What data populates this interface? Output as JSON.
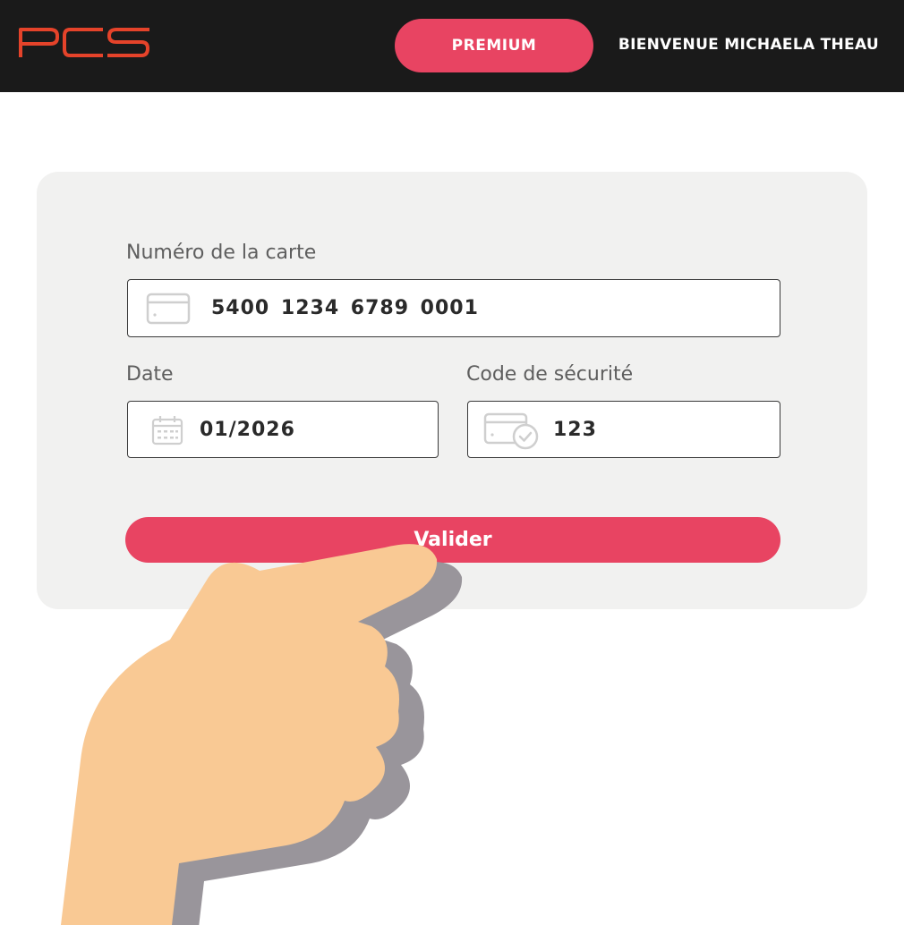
{
  "header": {
    "logo_text": "PCS",
    "premium_label": "PREMIUM",
    "welcome_text": "BIENVENUE MICHAELA THEAU"
  },
  "form": {
    "card_number_label": "Numéro de la carte",
    "card_number_value": "5400  1234  6789  0001",
    "date_label": "Date",
    "date_value": "01/2026",
    "security_label": "Code de sécurité",
    "security_value": "123",
    "submit_label": "Valider"
  },
  "colors": {
    "accent": "#e84462",
    "logo": "#e5432a",
    "header_bg": "#1a1a1a",
    "card_bg": "#f1f1f0",
    "skin": "#f9c994"
  },
  "icons": [
    "credit-card-icon",
    "calendar-icon",
    "card-verified-icon",
    "pointing-hand-illustration"
  ]
}
